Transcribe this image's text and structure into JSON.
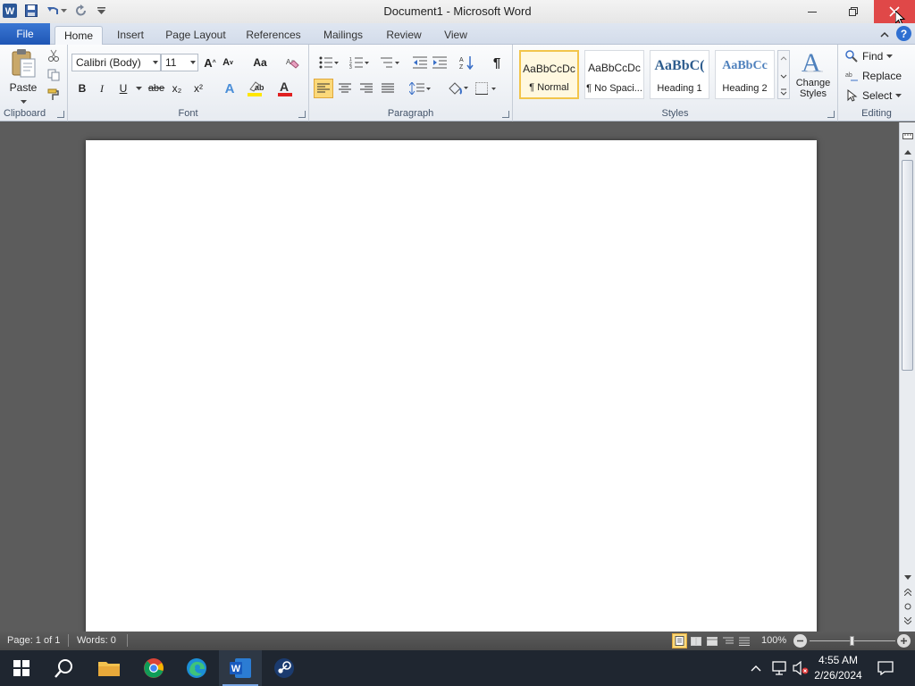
{
  "window": {
    "title": "Document1  -  Microsoft Word",
    "app_icon": "word-icon",
    "qat": [
      "save-icon",
      "undo-icon",
      "redo-icon",
      "customize-qat-icon"
    ],
    "controls": [
      "minimize-icon",
      "restore-icon",
      "close-icon"
    ]
  },
  "tabs": [
    {
      "label": "File"
    },
    {
      "label": "Home"
    },
    {
      "label": "Insert"
    },
    {
      "label": "Page Layout"
    },
    {
      "label": "References"
    },
    {
      "label": "Mailings"
    },
    {
      "label": "Review"
    },
    {
      "label": "View"
    }
  ],
  "ribbon": {
    "clipboard": {
      "label": "Clipboard",
      "paste": "Paste"
    },
    "font": {
      "label": "Font",
      "font_name": "Calibri (Body)",
      "font_size": "11",
      "change_case": "Aa",
      "bold": "B",
      "italic": "I",
      "underline": "U",
      "strike": "abe",
      "subscript": "x₂",
      "superscript": "x²",
      "highlight_color": "#ffe600",
      "font_color": "#e02020"
    },
    "paragraph": {
      "label": "Paragraph",
      "pilcrow": "¶"
    },
    "styles": {
      "label": "Styles",
      "items": [
        {
          "sample": "AaBbCcDc",
          "name": "¶ Normal"
        },
        {
          "sample": "AaBbCcDc",
          "name": "¶ No Spaci..."
        },
        {
          "sample": "AaBbC(",
          "name": "Heading 1"
        },
        {
          "sample": "AaBbCc",
          "name": "Heading 2"
        }
      ],
      "change_styles": "Change Styles"
    },
    "editing": {
      "label": "Editing",
      "find": "Find",
      "replace": "Replace",
      "select": "Select"
    }
  },
  "status": {
    "page": "Page: 1 of 1",
    "words": "Words: 0",
    "zoom": "100%",
    "zoom_level_percent": 100
  },
  "taskbar": {
    "apps": [
      "start-icon",
      "search-icon",
      "file-explorer-icon",
      "chrome-icon",
      "edge-icon",
      "word-icon",
      "steam-icon"
    ],
    "active": "word-icon",
    "time": "4:55 AM",
    "date": "2/26/2024"
  },
  "colors": {
    "file_tab": "#2b67c6",
    "close_hover": "#e04848",
    "active_style_border": "#f2c54b",
    "heading_blue": "#2e5d8e"
  }
}
